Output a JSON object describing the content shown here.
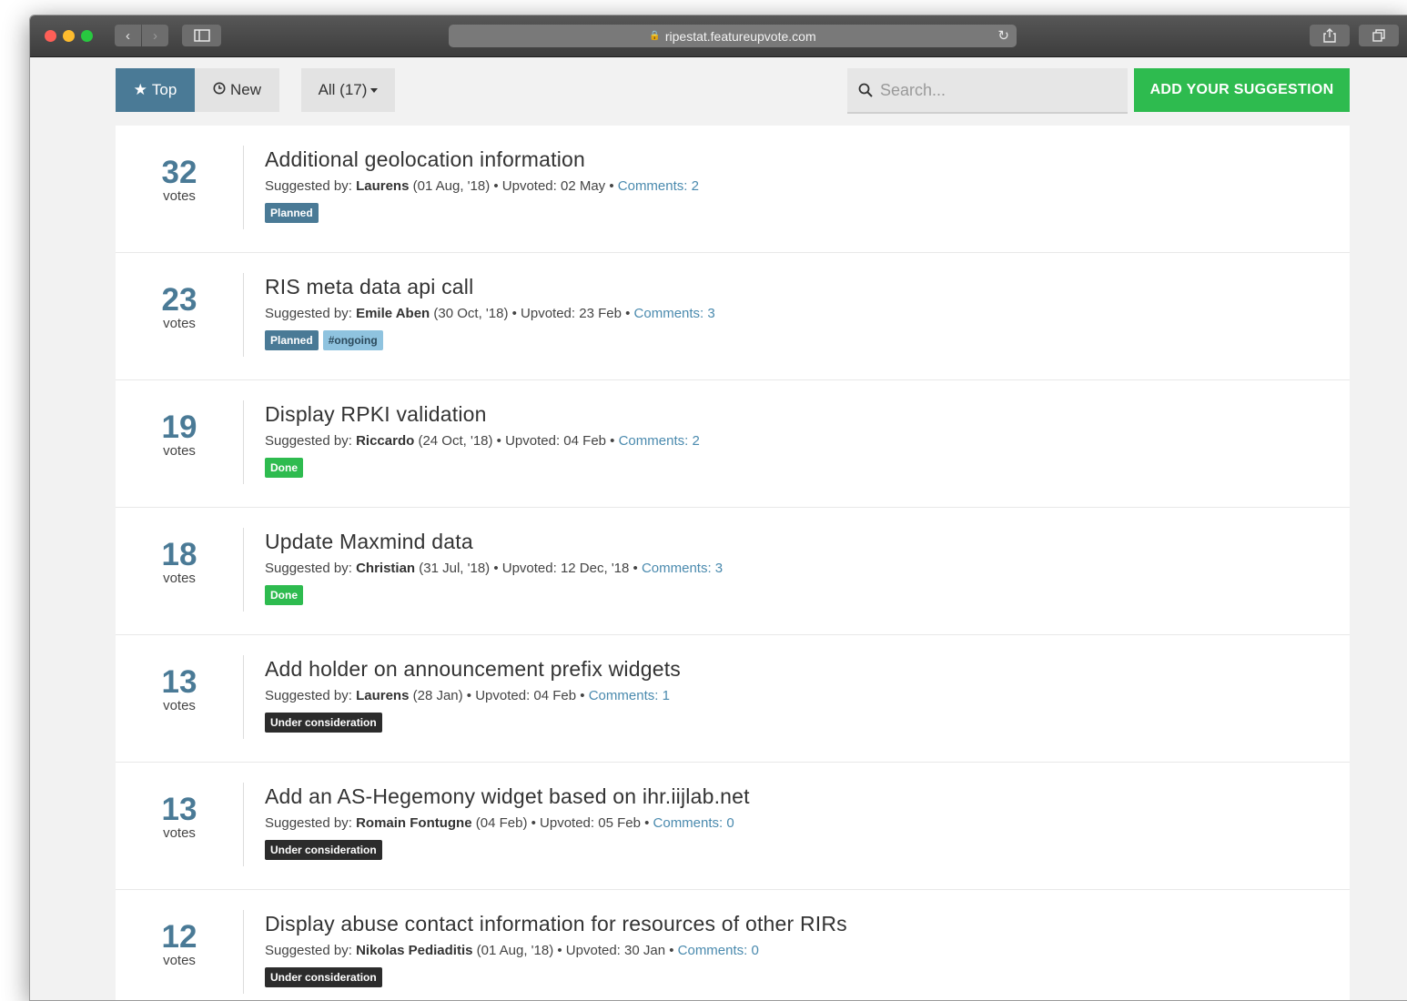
{
  "browser": {
    "url": "ripestat.featureupvote.com"
  },
  "toolbar": {
    "top_label": "Top",
    "new_label": "New",
    "filter_label": "All (17)",
    "search_placeholder": "Search...",
    "add_label": "ADD YOUR SUGGESTION"
  },
  "colors": {
    "accent": "#4a7a96",
    "add_button": "#2ebb4f",
    "status_planned": "#4a7a96",
    "status_done": "#2ebb4f",
    "status_under_consideration": "#2c2c2c",
    "tag_ongoing": "#8fc3df"
  },
  "suggestions": [
    {
      "votes": "32",
      "votes_label": "votes",
      "title": "Additional geolocation information",
      "suggested_by_label": "Suggested by:",
      "author": "Laurens",
      "meta": " (01 Aug, '18) • Upvoted: 02 May • ",
      "comments": "Comments: 2",
      "tags": [
        {
          "label": "Planned",
          "kind": "planned"
        }
      ]
    },
    {
      "votes": "23",
      "votes_label": "votes",
      "title": "RIS meta data api call",
      "suggested_by_label": "Suggested by:",
      "author": "Emile Aben",
      "meta": " (30 Oct, '18) • Upvoted: 23 Feb • ",
      "comments": "Comments: 3",
      "tags": [
        {
          "label": "Planned",
          "kind": "planned"
        },
        {
          "label": "#ongoing",
          "kind": "ongoing"
        }
      ]
    },
    {
      "votes": "19",
      "votes_label": "votes",
      "title": "Display RPKI validation",
      "suggested_by_label": "Suggested by:",
      "author": "Riccardo",
      "meta": " (24 Oct, '18) • Upvoted: 04 Feb • ",
      "comments": "Comments: 2",
      "tags": [
        {
          "label": "Done",
          "kind": "done"
        }
      ]
    },
    {
      "votes": "18",
      "votes_label": "votes",
      "title": "Update Maxmind data",
      "suggested_by_label": "Suggested by:",
      "author": "Christian",
      "meta": " (31 Jul, '18) • Upvoted: 12 Dec, '18 • ",
      "comments": "Comments: 3",
      "tags": [
        {
          "label": "Done",
          "kind": "done"
        }
      ]
    },
    {
      "votes": "13",
      "votes_label": "votes",
      "title": "Add holder on announcement prefix widgets",
      "suggested_by_label": "Suggested by:",
      "author": "Laurens",
      "meta": " (28 Jan) • Upvoted: 04 Feb • ",
      "comments": "Comments: 1",
      "tags": [
        {
          "label": "Under consideration",
          "kind": "uc"
        }
      ]
    },
    {
      "votes": "13",
      "votes_label": "votes",
      "title": "Add an AS-Hegemony widget based on ihr.iijlab.net",
      "suggested_by_label": "Suggested by:",
      "author": "Romain Fontugne",
      "meta": " (04 Feb) • Upvoted: 05 Feb • ",
      "comments": "Comments: 0",
      "tags": [
        {
          "label": "Under consideration",
          "kind": "uc"
        }
      ]
    },
    {
      "votes": "12",
      "votes_label": "votes",
      "title": "Display abuse contact information for resources of other RIRs",
      "suggested_by_label": "Suggested by:",
      "author": "Nikolas Pediaditis",
      "meta": " (01 Aug, '18) • Upvoted: 30 Jan • ",
      "comments": "Comments: 0",
      "tags": [
        {
          "label": "Under consideration",
          "kind": "uc"
        }
      ]
    }
  ]
}
